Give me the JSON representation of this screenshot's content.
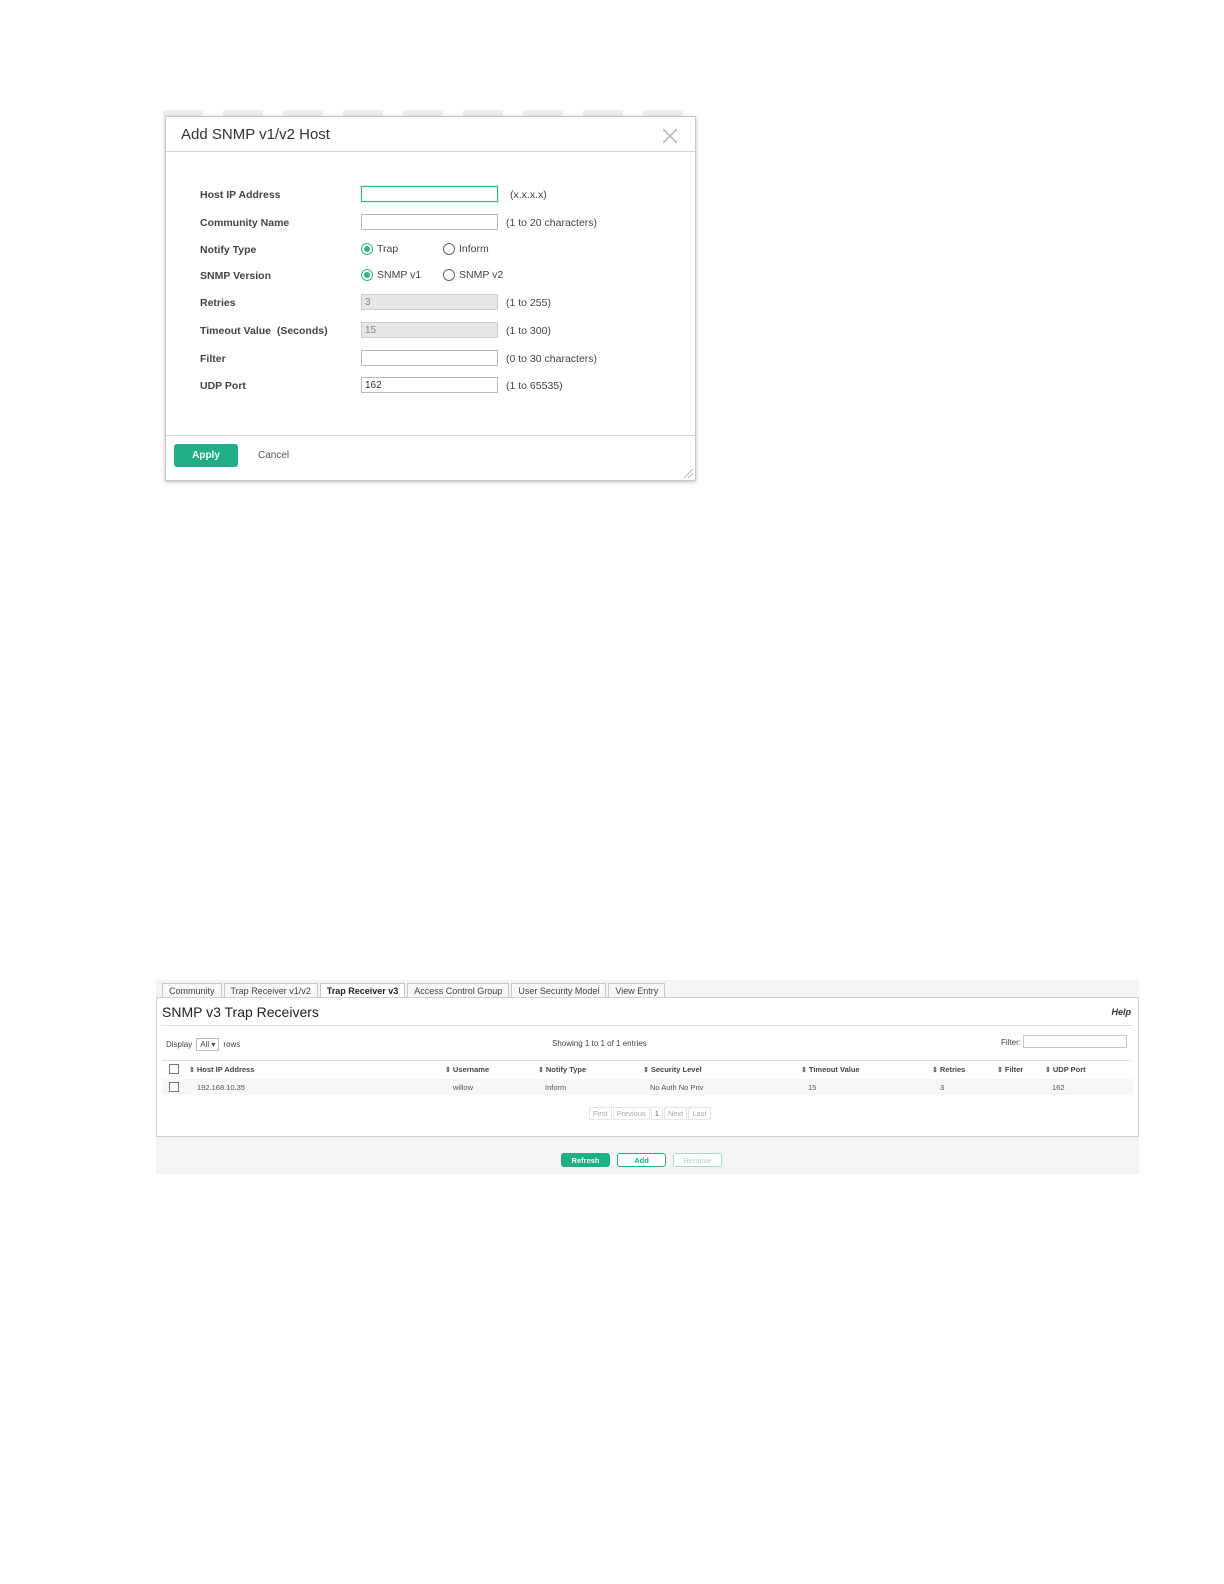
{
  "dialog": {
    "title": "Add SNMP v1/v2 Host",
    "fields": {
      "host_ip": {
        "label": "Host IP Address",
        "value": "",
        "hint": "(x.x.x.x)"
      },
      "community": {
        "label": "Community Name",
        "value": "",
        "hint": "(1 to 20 characters)"
      },
      "notify_type": {
        "label": "Notify Type",
        "options": [
          "Trap",
          "Inform"
        ],
        "selected": "Trap"
      },
      "snmp_version": {
        "label": "SNMP Version",
        "options": [
          "SNMP v1",
          "SNMP v2"
        ],
        "selected": "SNMP v1"
      },
      "retries": {
        "label": "Retries",
        "value": "3",
        "hint": "(1 to 255)"
      },
      "timeout": {
        "label": "Timeout Value  (Seconds)",
        "value": "15",
        "hint": "(1 to 300)"
      },
      "filter": {
        "label": "Filter",
        "value": "",
        "hint": "(0 to 30 characters)"
      },
      "udp_port": {
        "label": "UDP Port",
        "value": "162",
        "hint": "(1 to 65535)"
      }
    },
    "apply_label": "Apply",
    "cancel_label": "Cancel"
  },
  "page": {
    "tabs": [
      "Community",
      "Trap Receiver v1/v2",
      "Trap Receiver v3",
      "Access Control Group",
      "User Security Model",
      "View Entry"
    ],
    "active_tab": "Trap Receiver v3",
    "title": "SNMP v3 Trap Receivers",
    "help": "Help",
    "display_label": "Display",
    "display_value": "All",
    "rows_label": "rows",
    "showing": "Showing 1 to 1 of 1 entries",
    "filter_label": "Filter:",
    "columns": [
      "Host IP Address",
      "Username",
      "Notify Type",
      "Security Level",
      "Timeout Value",
      "Retries",
      "Filter",
      "UDP Port"
    ],
    "rows": [
      [
        "192.168.10.35",
        "willow",
        "Inform",
        "No Auth No Priv",
        "15",
        "3",
        "",
        "162"
      ]
    ],
    "pager": [
      "First",
      "Previous",
      "1",
      "Next",
      "Last"
    ],
    "buttons": {
      "refresh": "Refresh",
      "add": "Add",
      "remove": "Remove"
    }
  },
  "colors": {
    "accent": "#1fae86",
    "focus": "#31b58f"
  }
}
